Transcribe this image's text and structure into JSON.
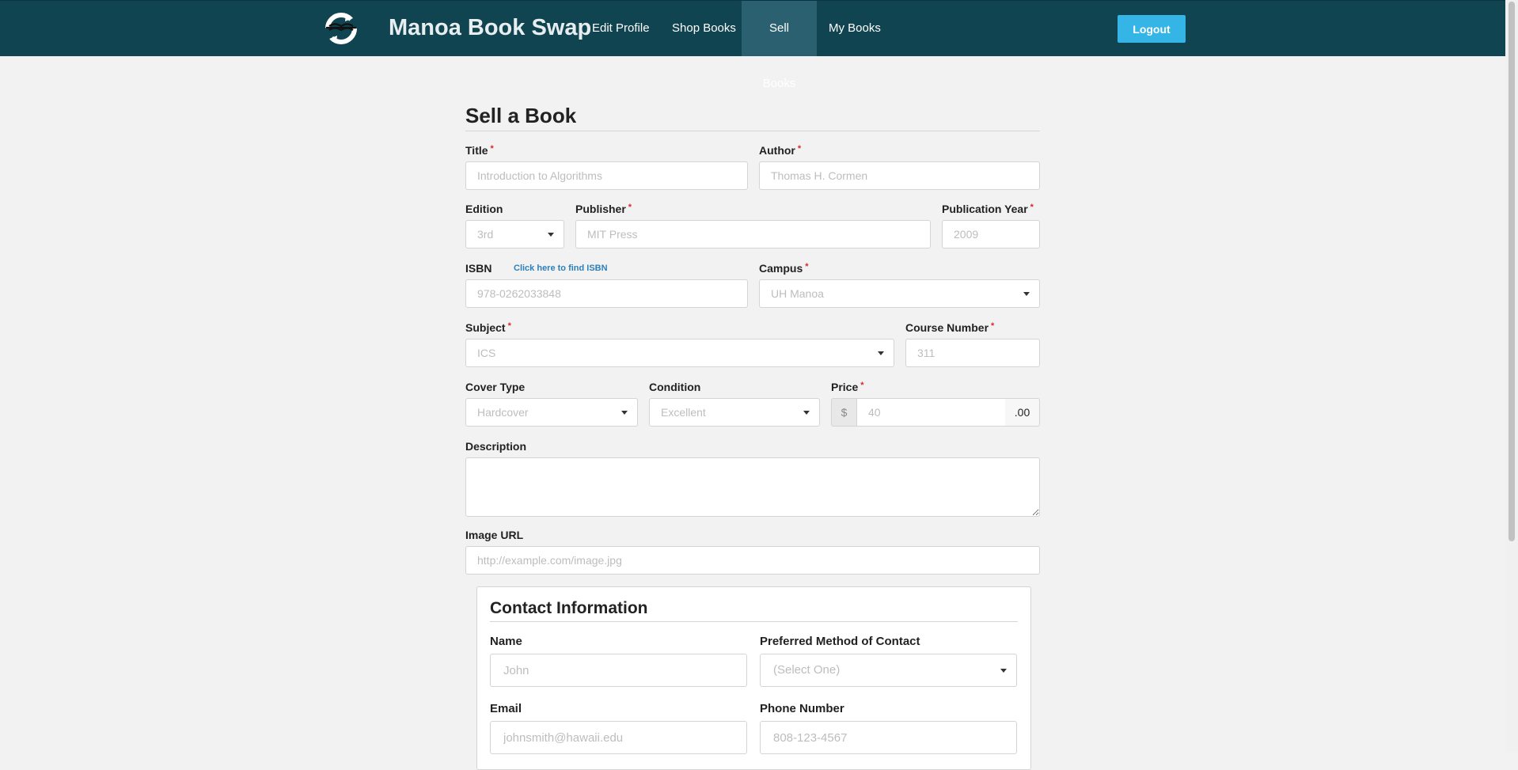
{
  "nav": {
    "brand": "Manoa Book Swap",
    "links": [
      "Edit Profile",
      "Shop Books",
      "Sell Books",
      "My Books"
    ],
    "active": "Sell Books",
    "logout": "Logout"
  },
  "form": {
    "heading": "Sell a Book",
    "title": {
      "label": "Title",
      "placeholder": "Introduction to Algorithms"
    },
    "author": {
      "label": "Author",
      "placeholder": "Thomas H. Cormen"
    },
    "edition": {
      "label": "Edition",
      "value": "3rd"
    },
    "publisher": {
      "label": "Publisher",
      "placeholder": "MIT Press"
    },
    "pub_year": {
      "label": "Publication Year",
      "placeholder": "2009"
    },
    "isbn": {
      "label": "ISBN",
      "link": "Click here to find ISBN",
      "placeholder": "978-0262033848"
    },
    "campus": {
      "label": "Campus",
      "value": "UH Manoa"
    },
    "subject": {
      "label": "Subject",
      "value": "ICS"
    },
    "course": {
      "label": "Course Number",
      "placeholder": "311"
    },
    "cover": {
      "label": "Cover Type",
      "value": "Hardcover"
    },
    "condition": {
      "label": "Condition",
      "value": "Excellent"
    },
    "price": {
      "label": "Price",
      "prefix": "$",
      "placeholder": "40",
      "suffix": ".00"
    },
    "description": {
      "label": "Description"
    },
    "image_url": {
      "label": "Image URL",
      "placeholder": "http://example.com/image.jpg"
    }
  },
  "contact": {
    "heading": "Contact Information",
    "name": {
      "label": "Name",
      "placeholder": "John"
    },
    "method": {
      "label": "Preferred Method of Contact",
      "value": "(Select One)"
    },
    "email": {
      "label": "Email",
      "placeholder": "johnsmith@hawaii.edu"
    },
    "phone": {
      "label": "Phone Number",
      "placeholder": "808-123-4567"
    }
  },
  "colors": {
    "nav_bg": "#0f4450",
    "logout_bg": "#35b5e5",
    "required": "#db2828",
    "link": "#2d7fb8"
  }
}
